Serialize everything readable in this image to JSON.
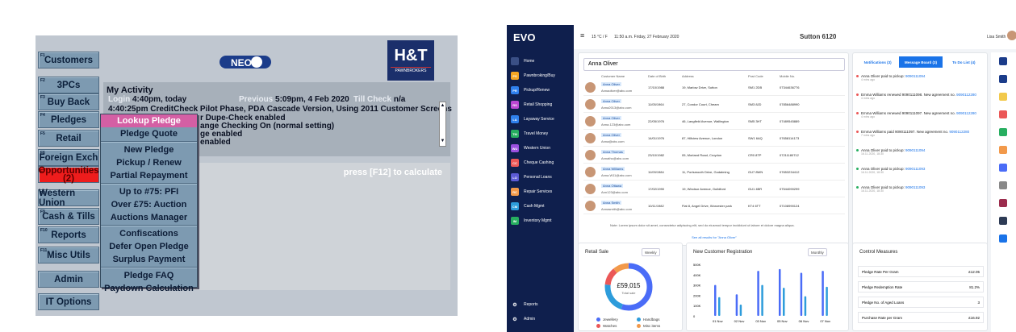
{
  "legacy": {
    "buttons": [
      {
        "fkey": "F1",
        "label": "Customers"
      },
      {
        "fkey": "F2",
        "label": "3PCs"
      },
      {
        "fkey": "F3",
        "label": "Buy Back"
      },
      {
        "fkey": "F4",
        "label": "Pledges"
      },
      {
        "fkey": "F5",
        "label": "Retail"
      },
      {
        "fkey": "F6",
        "label": "Foreign Exch"
      },
      {
        "fkey": "F7",
        "label": "Opportunities",
        "sub": "(2)"
      },
      {
        "fkey": "F8",
        "label": "Western Union"
      },
      {
        "fkey": "F9",
        "label": "Cash & Tills"
      },
      {
        "fkey": "F10",
        "label": "Reports"
      },
      {
        "fkey": "F11",
        "label": "Misc Utils"
      },
      {
        "fkey": "",
        "label": "Admin"
      },
      {
        "fkey": "",
        "label": "IT Options"
      }
    ],
    "logo_neo": "NEO",
    "brand": {
      "name": "H&T",
      "tag": "PAWNBROKERS"
    },
    "activity": {
      "title": "My Activity",
      "login_label": "Login",
      "login_value": "4:40pm, today",
      "previous_label": "Previous",
      "previous_value": "5:09pm, 4 Feb 2020",
      "till_label": "Till Check",
      "till_value": "n/a",
      "line1": "4:40:25pm  CreditCheck Pilot Phase, PDA Cascade Version, Using 2011 Customer Screens",
      "line2": "r Dupe-Check enabled",
      "line3": "ange Checking On (normal setting)",
      "line4": "ge enabled",
      "line5": "enabled"
    },
    "calc_hint": "press [F12] to calculate",
    "menu": [
      [
        "Lookup Pledge",
        "Pledge Quote"
      ],
      [
        "New Pledge",
        "Pickup / Renew",
        "Partial Repayment"
      ],
      [
        "Up to #75: PFI",
        "Over £75: Auction",
        "Auctions Manager"
      ],
      [
        "Confiscations",
        "Defer Open Pledge",
        "Surplus Payment"
      ],
      [
        "Pledge FAQ",
        "Paydown Calculation"
      ]
    ]
  },
  "evo": {
    "logo": "EVO",
    "topbar": {
      "weather": "15 °C / F",
      "datetime": "11:50 a.m. Friday, 27 February 2020",
      "center": "Sutton 6120",
      "user": "Lisa Smith"
    },
    "nav": [
      {
        "code": "",
        "label": "Home",
        "color": "#3a4f85"
      },
      {
        "code": "PS",
        "label": "Pawnbroking/Buy",
        "color": "#f5a623"
      },
      {
        "code": "PR",
        "label": "Pickup/Renew",
        "color": "#2f80ed"
      },
      {
        "code": "RS",
        "label": "Retail Shopping",
        "color": "#bb47d4"
      },
      {
        "code": "LA",
        "label": "Layaway Service",
        "color": "#2f80ed"
      },
      {
        "code": "TM",
        "label": "Travel Money",
        "color": "#27ae60"
      },
      {
        "code": "WU",
        "label": "Western Union",
        "color": "#9b51e0"
      },
      {
        "code": "CC",
        "label": "Cheque Cashing",
        "color": "#eb5757"
      },
      {
        "code": "LO",
        "label": "Personal Loans",
        "color": "#5b5bd6"
      },
      {
        "code": "RC",
        "label": "Repair Services",
        "color": "#f2994a"
      },
      {
        "code": "CM",
        "label": "Cash Mgmt",
        "color": "#2d9cdb"
      },
      {
        "code": "IM",
        "label": "Inventory Mgmt",
        "color": "#27ae60"
      }
    ],
    "nav_bottom": [
      {
        "label": "Reports"
      },
      {
        "label": "Admin"
      }
    ],
    "search": {
      "value": "Anna Oliver"
    },
    "table": {
      "headers": [
        "Customer Name",
        "Date of Birth",
        "Address",
        "Post Code",
        "Mobile No."
      ],
      "rows": [
        [
          "Anna Oliver",
          "Annaoliver@abc.com",
          "17/10/1988",
          "19, Marlow Drive, Sutton",
          "SM1 2DB",
          "07344636776"
        ],
        [
          "Anna Oliver",
          "Anna2013@abc.com",
          "11/05/1964",
          "27, Condor Court, Cheam",
          "SM3 8JD",
          "07856488990"
        ],
        [
          "Anna Oliver",
          "Anna.123@abc.com",
          "22/05/1976",
          "46, Langfield Avenue, Wallington",
          "SM5 3HT",
          "07489545889"
        ],
        [
          "Anna Oliver",
          "Anna@abc.com",
          "14/01/1976",
          "87, Hillview Avenue, London",
          "SW1 6AQ",
          "07658114173"
        ],
        [
          "Anna Thomas",
          "Annatho@abc.com",
          "23/10/1982",
          "05, Morland Road, Croydon",
          "CR0 8TP",
          "07211180712"
        ],
        [
          "Anna Williams",
          "Anna.W11@abc.com",
          "11/09/1984",
          "11, Portsmouth Drive, Godalming",
          "GU7 8WN",
          "07653234412"
        ],
        [
          "Anna Ottawa",
          "Ann123@abc.com",
          "17/02/1990",
          "19, Windsor Avenue, Guildford",
          "GU1 4BR",
          "07544090299"
        ],
        [
          "Anna Smith",
          "Annasmith@abc.com",
          "10/11/1982",
          "Flat 8, Angel Drive, Worcester park",
          "KT4 6TT",
          "07108990124"
        ]
      ],
      "more": "See all results for \"Anna Oliver\""
    },
    "note": "Note: Lorem ipsum dolor sit amet, consectetur adipiscing elit, sed do eiusmod tempor incididunt ut labore et dolore magna aliqua.",
    "tabs": [
      "Notifications (3)",
      "Message Board (3)",
      "To Do List (4)"
    ],
    "notifications": [
      {
        "text": "Anna Oliver paid to pickup: ",
        "link": "9090111094",
        "time": "4 mins ago",
        "color": "#eb5757"
      },
      {
        "text": "Emma Williams renewed 9090111098. New agreement no. ",
        "link": "9090112280",
        "time": "4 mins ago",
        "color": "#eb5757"
      },
      {
        "text": "Emma Williams renewed 9090111097. New agreement no. ",
        "link": "9090112280",
        "time": "4 mins ago",
        "color": "#eb5757"
      },
      {
        "text": "Emma Williams paid 9090111097. New agreement no. ",
        "link": "9090112280",
        "time": "7 mins ago",
        "color": "#eb5757"
      },
      {
        "text": "Anna Oliver paid to pickup: ",
        "link": "9090111094",
        "time": "16.11.2020, 18:30",
        "color": "#27ae60"
      },
      {
        "text": "Anna Oliver paid to pickup: ",
        "link": "9090111093",
        "time": "16.11.2020, 18:30",
        "color": "#27ae60"
      },
      {
        "text": "Anna Oliver paid to pickup: ",
        "link": "9090111093",
        "time": "16.11.2020, 18:30",
        "color": "#27ae60"
      }
    ],
    "retail": {
      "title": "Retail Sale",
      "period": "Weekly",
      "total": "£59,015",
      "total_label": "Total sale",
      "legend": [
        {
          "label": "Jewellery",
          "color": "#4a6cf7"
        },
        {
          "label": "Handbags",
          "color": "#2d9cdb"
        },
        {
          "label": "Watches",
          "color": "#eb5757"
        },
        {
          "label": "Misc items",
          "color": "#f2994a"
        }
      ]
    },
    "ncr": {
      "title": "New Customer Registration",
      "period": "Monthly"
    },
    "control": {
      "title": "Control Measures",
      "rows": [
        [
          "Pledge Rate Per Gram",
          "£12.05"
        ],
        [
          "Pledge Redemption Rate",
          "81.2%"
        ],
        [
          "Pledge No. of Aged Loans",
          "3"
        ],
        [
          "Purchase Rate per Gram",
          "£16.92"
        ]
      ]
    }
  },
  "chart_data": {
    "type": "bar",
    "categories": [
      "01 Nov",
      "02 Nov",
      "03 Nov",
      "05 Nov",
      "06 Nov",
      "07 Nov"
    ],
    "series": [
      {
        "values": [
          330,
          230,
          480,
          500,
          460,
          480
        ],
        "color": "#4a6cf7"
      },
      {
        "values": [
          200,
          120,
          330,
          300,
          210,
          310
        ],
        "color": "#2d9cdb"
      }
    ],
    "yticks": [
      "500K",
      "400K",
      "300K",
      "200K",
      "100K",
      "0"
    ],
    "ylim": [
      0,
      550
    ]
  }
}
